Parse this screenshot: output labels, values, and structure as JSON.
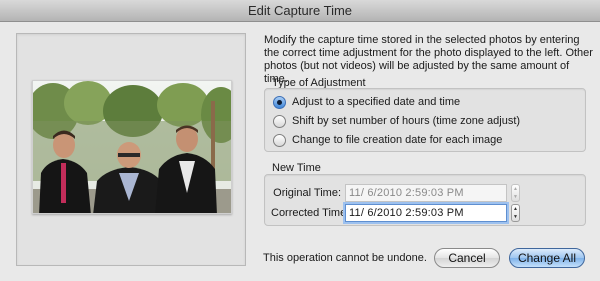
{
  "window": {
    "title": "Edit Capture Time"
  },
  "description": "Modify the capture time stored in the selected photos by entering the correct time adjustment for the photo displayed to the left. Other photos (but not videos) will be adjusted by the same amount of time.",
  "adjustment": {
    "label": "Type of Adjustment",
    "options": [
      {
        "label": "Adjust to a specified date and time",
        "selected": true
      },
      {
        "label": "Shift by set number of hours (time zone adjust)",
        "selected": false
      },
      {
        "label": "Change to file creation date for each image",
        "selected": false
      }
    ]
  },
  "new_time": {
    "label": "New Time",
    "original_label": "Original Time:",
    "original_value": "11/  6/2010   2:59:03 PM",
    "corrected_label": "Corrected Time:",
    "corrected_value": "11/  6/2010   2:59:03 PM"
  },
  "footer": {
    "warning": "This operation cannot be undone.",
    "cancel_label": "Cancel",
    "change_all_label": "Change All"
  },
  "icons": {
    "stepper_up": "▲",
    "stepper_down": "▼"
  },
  "colors": {
    "accent": "#3f86d8",
    "default_button": "#7fb2ea"
  }
}
